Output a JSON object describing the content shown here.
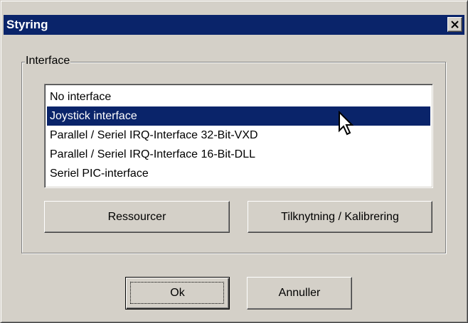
{
  "window": {
    "title": "Styring",
    "close_icon": "close-icon"
  },
  "interface_group": {
    "label": "Interface",
    "items": [
      {
        "label": "No interface",
        "selected": false
      },
      {
        "label": "Joystick interface",
        "selected": true
      },
      {
        "label": "Parallel / Seriel IRQ-Interface 32-Bit-VXD",
        "selected": false
      },
      {
        "label": "Parallel / Seriel IRQ-Interface 16-Bit-DLL",
        "selected": false
      },
      {
        "label": "Seriel PIC-interface",
        "selected": false
      }
    ],
    "resources_label": "Ressourcer",
    "calibration_label": "Tilknytning / Kalibrering"
  },
  "footer": {
    "ok_label": "Ok",
    "cancel_label": "Annuller"
  },
  "colors": {
    "titlebar": "#0a246a",
    "selection": "#0a246a",
    "face": "#d4d0c8"
  },
  "cursor_icon": "mouse-pointer-icon"
}
